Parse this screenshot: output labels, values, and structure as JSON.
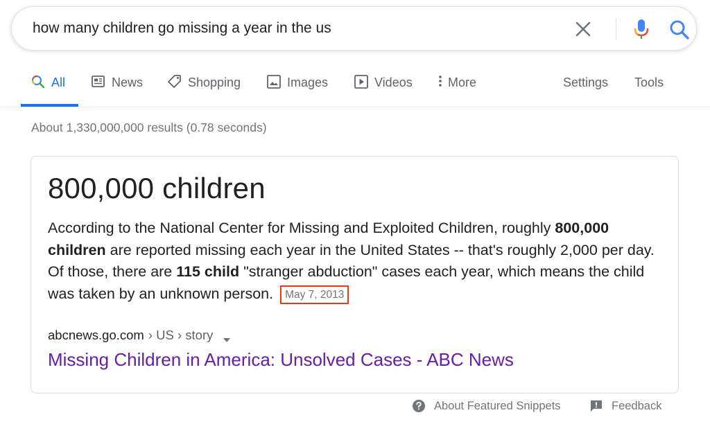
{
  "search": {
    "query": "how many children go missing a year in the us"
  },
  "tabs": [
    {
      "label": "All",
      "icon": "search-icon",
      "active": true
    },
    {
      "label": "News",
      "icon": "news-icon"
    },
    {
      "label": "Shopping",
      "icon": "tag-icon"
    },
    {
      "label": "Images",
      "icon": "image-icon"
    },
    {
      "label": "Videos",
      "icon": "play-icon"
    },
    {
      "label": "More",
      "icon": "more-vertical-icon"
    }
  ],
  "tools": {
    "settings_label": "Settings",
    "tools_label": "Tools"
  },
  "result_stats": "About 1,330,000,000 results (0.78 seconds)",
  "snippet": {
    "answer": "800,000 children",
    "text_parts": [
      "According to the National Center for Missing and Exploited Children, roughly ",
      "800,000 children",
      " are reported missing each year in the United States -- that's roughly 2,000 per day. Of those, there are ",
      "115 child",
      " \"stranger abduction\" cases each year, which means the child was taken by an unknown person."
    ],
    "date": "May 7, 2013",
    "cite_domain": "abcnews.go.com",
    "cite_path": "› US › story",
    "link_title": "Missing Children in America: Unsolved Cases - ABC News"
  },
  "footer": {
    "about_label": "About Featured Snippets",
    "feedback_label": "Feedback"
  },
  "colors": {
    "accent": "#1a73e8",
    "visited_link": "#681da8",
    "highlight_box": "#e8391b"
  }
}
